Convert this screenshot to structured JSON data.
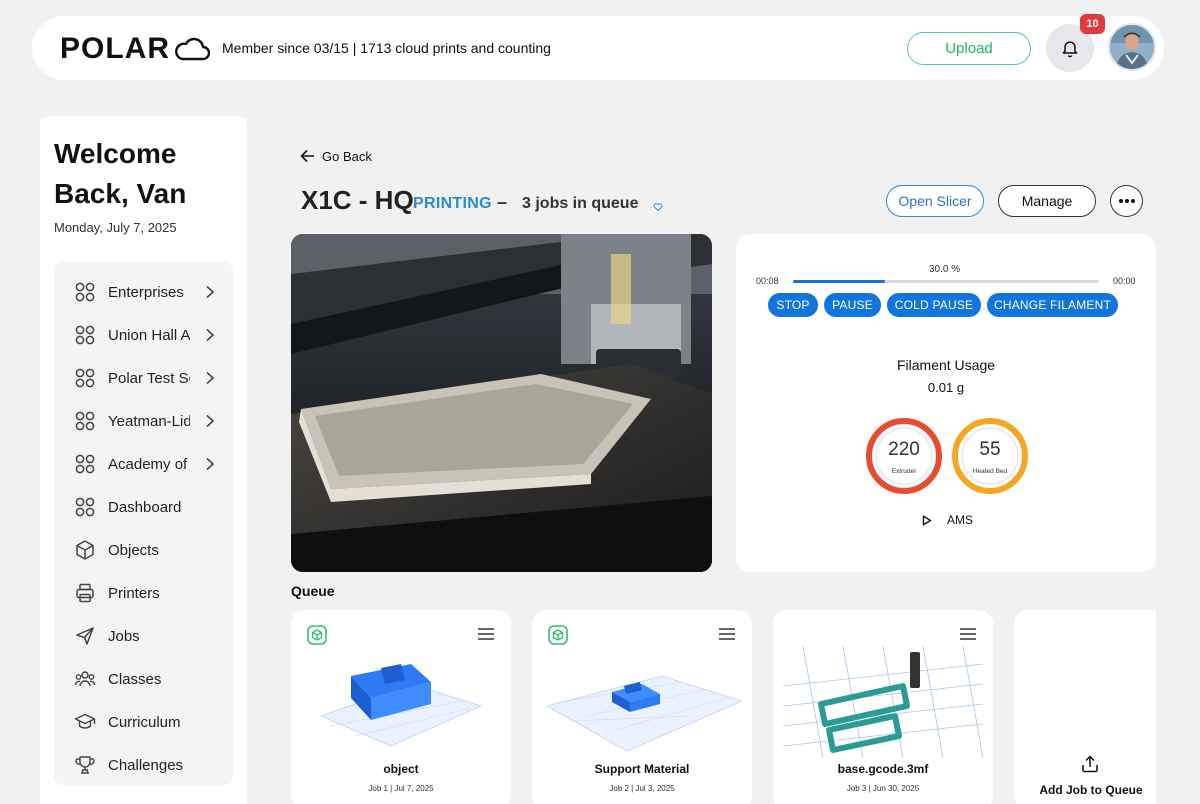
{
  "header": {
    "logo_text": "POLAR",
    "member_text": "Member since 03/15 | 1713 cloud prints and counting",
    "upload_label": "Upload",
    "notification_count": "10"
  },
  "sidebar": {
    "welcome": "Welcome Back, Van",
    "date": "Monday, July 7, 2025",
    "items": [
      {
        "label": "Enterprises",
        "icon": "grid-icon"
      },
      {
        "label": "Union Hall Academy",
        "icon": "grid-icon"
      },
      {
        "label": "Polar Test School",
        "icon": "grid-icon"
      },
      {
        "label": "Yeatman-Liddell",
        "icon": "grid-icon"
      },
      {
        "label": "Academy of",
        "icon": "grid-icon"
      },
      {
        "label": "Dashboard",
        "icon": "grid-icon"
      },
      {
        "label": "Objects",
        "icon": "cube-icon"
      },
      {
        "label": "Printers",
        "icon": "printer-icon"
      },
      {
        "label": "Jobs",
        "icon": "send-icon"
      },
      {
        "label": "Classes",
        "icon": "users-icon"
      },
      {
        "label": "Curriculum",
        "icon": "graduation-cap-icon"
      },
      {
        "label": "Challenges",
        "icon": "trophy-icon"
      }
    ]
  },
  "main": {
    "go_back": "Go Back",
    "printer_name": "X1C - HQ",
    "status": "PRINTING",
    "separator": "–",
    "queue_text": "3 jobs in queue",
    "open_slicer": "Open Slicer",
    "manage": "Manage"
  },
  "control": {
    "elapsed": "00:08",
    "remaining": "00:00",
    "progress_text": "30.0 %",
    "progress": 0.3,
    "buttons": [
      "STOP",
      "PAUSE",
      "COLD PAUSE",
      "CHANGE FILAMENT"
    ],
    "filament_label": "Filament Usage",
    "filament_value": "0.01 g",
    "extruder_value": "220",
    "extruder_label": "Extruder",
    "bed_value": "55",
    "bed_label": "Heated Bed",
    "ams_label": "AMS",
    "colors": {
      "accent": "#1274dd",
      "extruder": "#ea4a32",
      "bed": "#f5a623",
      "status": "#2a8bd6"
    }
  },
  "queue": {
    "title": "Queue",
    "jobs": [
      {
        "name": "object",
        "meta": "Job 1 | Jul 7, 2025"
      },
      {
        "name": "Support Material",
        "meta": "Job 2 | Jul 3, 2025"
      },
      {
        "name": "base.gcode.3mf",
        "meta": "Job 3 | Jun 30, 2025"
      }
    ],
    "add_label": "Add Job to Queue"
  }
}
